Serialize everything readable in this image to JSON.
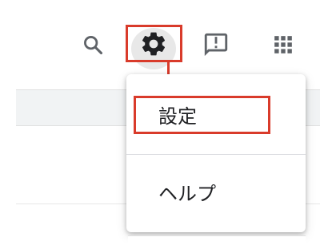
{
  "toolbar": {
    "search_icon": "search-icon",
    "settings_icon": "gear-icon",
    "feedback_icon": "feedback-icon",
    "apps_icon": "apps-grid-icon"
  },
  "settings_menu": {
    "items": [
      {
        "label": "設定"
      },
      {
        "label": "ヘルプ"
      }
    ]
  },
  "annotation": {
    "highlight_color": "#d93b2b"
  }
}
